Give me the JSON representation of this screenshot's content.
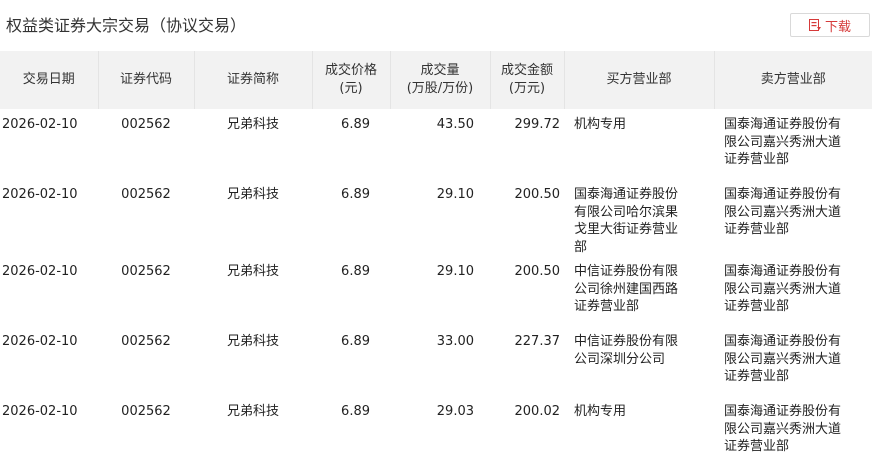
{
  "page": {
    "title": "权益类证券大宗交易（协议交易）",
    "download_label": "下载"
  },
  "colors": {
    "accent": "#d63a3a",
    "header_bg": "#f2f2f2"
  },
  "table": {
    "headers": [
      "交易日期",
      "证券代码",
      "证券简称",
      "成交价格\n(元)",
      "成交量\n(万股/万份)",
      "成交金额\n(万元)",
      "买方营业部",
      "卖方营业部"
    ],
    "rows": [
      {
        "date": "2026-02-10",
        "code": "002562",
        "name": "兄弟科技",
        "price": "6.89",
        "volume": "43.50",
        "amount": "299.72",
        "buyer": "机构专用",
        "seller": "国泰海通证券股份有限公司嘉兴秀洲大道证券营业部"
      },
      {
        "date": "2026-02-10",
        "code": "002562",
        "name": "兄弟科技",
        "price": "6.89",
        "volume": "29.10",
        "amount": "200.50",
        "buyer": "国泰海通证券股份有限公司哈尔滨果戈里大街证券营业部",
        "seller": "国泰海通证券股份有限公司嘉兴秀洲大道证券营业部"
      },
      {
        "date": "2026-02-10",
        "code": "002562",
        "name": "兄弟科技",
        "price": "6.89",
        "volume": "29.10",
        "amount": "200.50",
        "buyer": "中信证券股份有限公司徐州建国西路证券营业部",
        "seller": "国泰海通证券股份有限公司嘉兴秀洲大道证券营业部"
      },
      {
        "date": "2026-02-10",
        "code": "002562",
        "name": "兄弟科技",
        "price": "6.89",
        "volume": "33.00",
        "amount": "227.37",
        "buyer": "中信证券股份有限公司深圳分公司",
        "seller": "国泰海通证券股份有限公司嘉兴秀洲大道证券营业部"
      },
      {
        "date": "2026-02-10",
        "code": "002562",
        "name": "兄弟科技",
        "price": "6.89",
        "volume": "29.03",
        "amount": "200.02",
        "buyer": "机构专用",
        "seller": "国泰海通证券股份有限公司嘉兴秀洲大道证券营业部"
      }
    ]
  }
}
